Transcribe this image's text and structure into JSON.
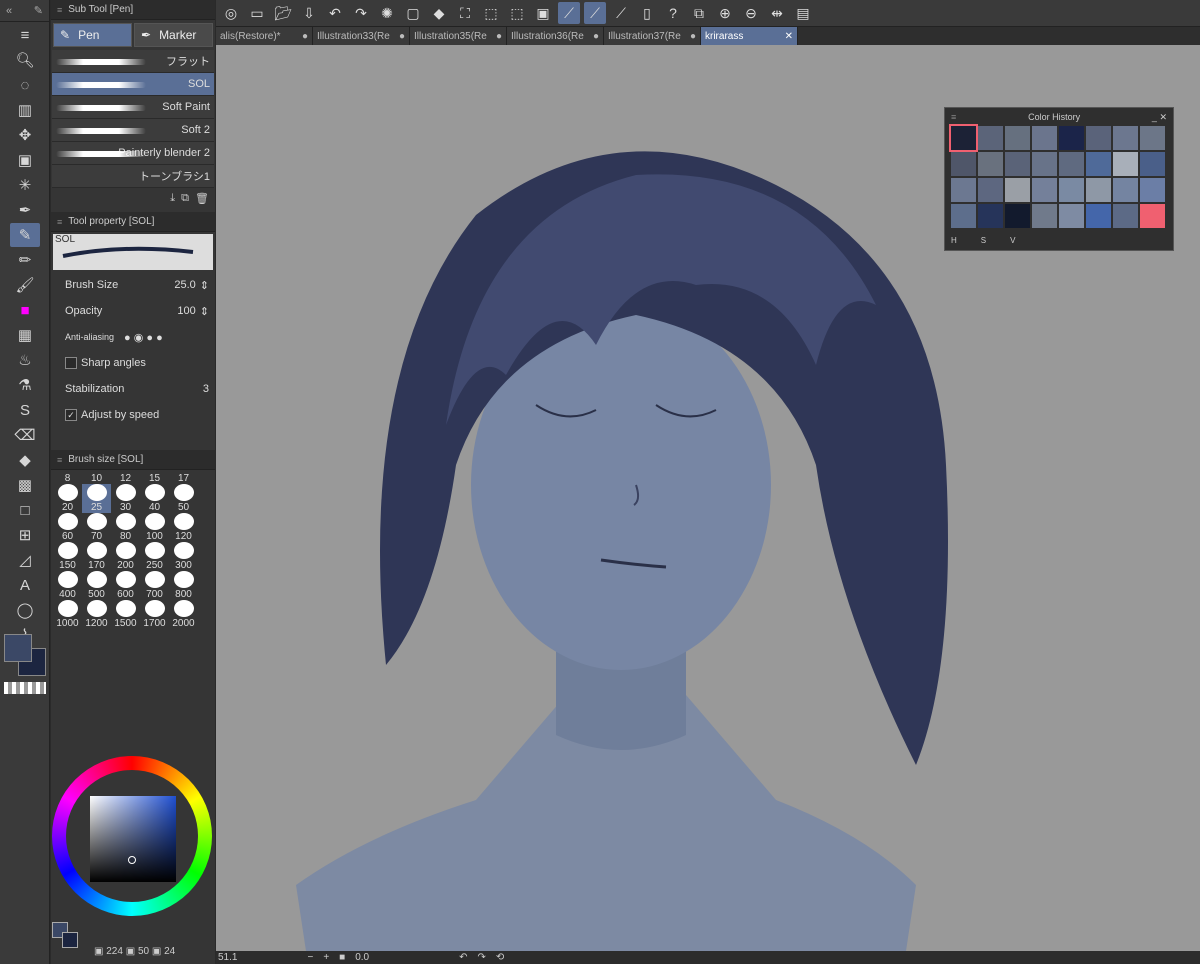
{
  "toolbar": {
    "tools": [
      "pen-tool",
      "zoom-icon",
      "lasso-select-icon",
      "layer-select-icon",
      "move-icon",
      "layer-move-icon",
      "auto-select-icon",
      "eyedropper-icon",
      "pen-icon",
      "pencil-icon",
      "brush-icon",
      "airbrush-icon",
      "decoration-icon",
      "blend-icon",
      "figure-icon",
      "eraser-icon",
      "fill-icon",
      "gradient-icon",
      "rectangle-icon",
      "frame-icon",
      "ruler-icon",
      "text-icon",
      "balloon-icon",
      "correction-icon"
    ]
  },
  "subtool": {
    "title": "Sub Tool [Pen]",
    "tabs": [
      "Pen",
      "Marker"
    ],
    "brushes": [
      "フラット",
      "SOL",
      "Soft Paint",
      "Soft 2",
      "Painterly blender 2",
      "トーンブラシ1"
    ]
  },
  "property": {
    "title": "Tool property [SOL]",
    "preview_name": "SOL",
    "brush_size_label": "Brush Size",
    "brush_size_value": "25.0",
    "opacity_label": "Opacity",
    "opacity_value": "100",
    "antialias_label": "Anti-aliasing",
    "sharp_label": "Sharp angles",
    "stabilization_label": "Stabilization",
    "stabilization_value": "3",
    "adjust_label": "Adjust by speed"
  },
  "brushsize": {
    "title": "Brush size [SOL]",
    "header": [
      "8",
      "10",
      "12",
      "15",
      "17"
    ],
    "rows": [
      [
        "20",
        "25",
        "30",
        "40",
        "50"
      ],
      [
        "60",
        "70",
        "80",
        "100",
        "120"
      ],
      [
        "150",
        "170",
        "200",
        "250",
        "300"
      ],
      [
        "400",
        "500",
        "600",
        "700",
        "800"
      ],
      [
        "1000",
        "1200",
        "1500",
        "1700",
        "2000"
      ]
    ],
    "selected": "25"
  },
  "color": {
    "main": "#3b4866",
    "sub": "#1c2540",
    "readout": {
      "h": "224",
      "s": "50",
      "v": "24"
    }
  },
  "doctabs": [
    {
      "label": "alis(Restore)*",
      "active": false
    },
    {
      "label": "Illustration33(Re",
      "active": false
    },
    {
      "label": "Illustration35(Re",
      "active": false
    },
    {
      "label": "Illustration36(Re",
      "active": false
    },
    {
      "label": "Illustration37(Re",
      "active": false
    },
    {
      "label": "krirarass",
      "active": true
    }
  ],
  "history": {
    "title": "Color History",
    "colors": [
      "#1c2236",
      "#5b6479",
      "#66707f",
      "#6b758d",
      "#1b2449",
      "#5a637a",
      "#6c778f",
      "#6c7688",
      "#4f5669",
      "#69717e",
      "#5a6378",
      "#687389",
      "#5f6a80",
      "#4f6a99",
      "#a8afb9",
      "#4a5f89",
      "#6c7891",
      "#5d6780",
      "#9a9fa6",
      "#74809a",
      "#7a8aa3",
      "#8e98a6",
      "#7484a1",
      "#6b7ea6",
      "#5d6e8c",
      "#26345a",
      "#121a2d",
      "#707a8b",
      "#7e8ba3",
      "#4466aa",
      "#5c6a86",
      "#f06070"
    ],
    "footer": [
      "H",
      "S",
      "V"
    ]
  },
  "status": {
    "zoom": "51.1",
    "angle": "0.0"
  }
}
